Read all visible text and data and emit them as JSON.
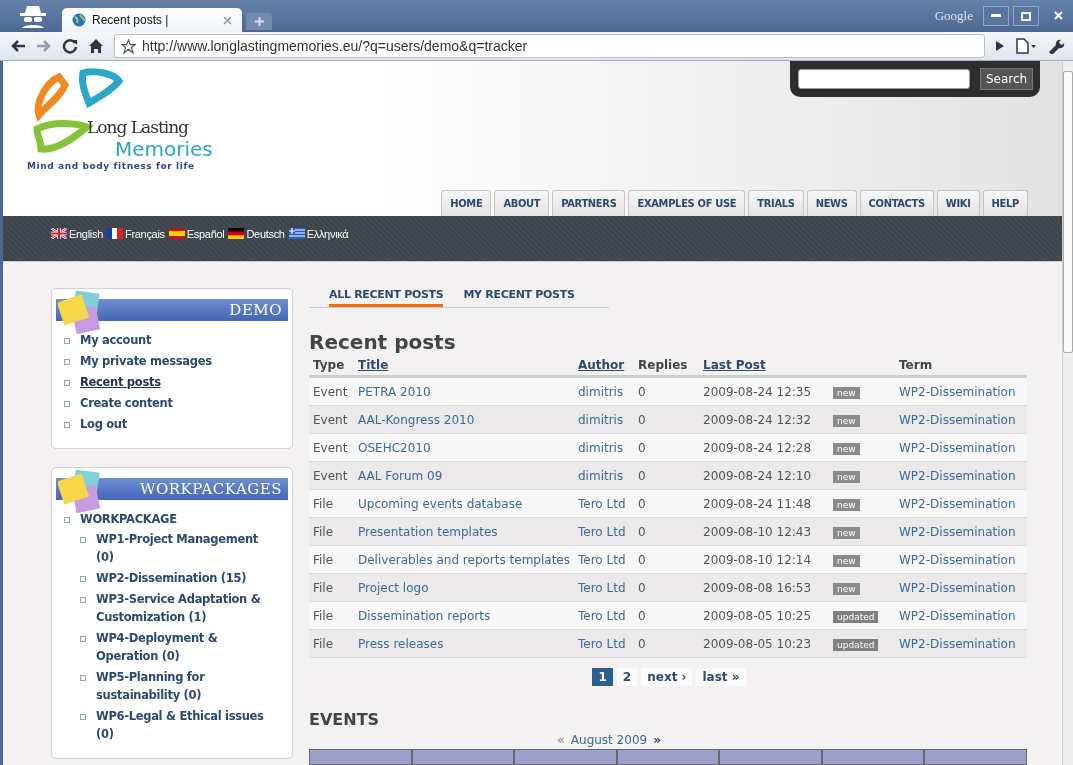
{
  "browser": {
    "tab_title": "Recent posts |",
    "search_engine": "Google",
    "url": "http://www.longlastingmemories.eu/?q=users/demo&q=tracker"
  },
  "site": {
    "logo_line1": "Long Lasting",
    "logo_line2": "Memories",
    "tagline": "Mind and body fitness for life",
    "search_button": "Search",
    "nav": [
      "HOME",
      "ABOUT",
      "PARTNERS",
      "EXAMPLES OF USE",
      "TRIALS",
      "NEWS",
      "CONTACTS",
      "WIKI",
      "HELP"
    ],
    "languages": [
      {
        "label": "English",
        "kind": "uk"
      },
      {
        "label": "Français",
        "kind": "fr"
      },
      {
        "label": "Español",
        "kind": "es"
      },
      {
        "label": "Deutsch",
        "kind": "de"
      },
      {
        "label": "Ελληνικά",
        "kind": "gr"
      }
    ]
  },
  "sidebar": [
    {
      "title": "DEMO",
      "items": [
        {
          "label": "My account",
          "selected": false
        },
        {
          "label": "My private messages",
          "selected": false
        },
        {
          "label": "Recent posts",
          "selected": true
        },
        {
          "label": "Create content",
          "selected": false
        },
        {
          "label": "Log out",
          "selected": false
        }
      ]
    },
    {
      "title": "WORKPACKAGES",
      "items": [
        {
          "label": "WORKPACKAGE",
          "selected": false,
          "children": [
            {
              "label": "WP1-Project Management (0)",
              "selected": false
            },
            {
              "label": "WP2-Dissemination (15)",
              "selected": false
            },
            {
              "label": "WP3-Service Adaptation & Customization (1)",
              "selected": false
            },
            {
              "label": "WP4-Deployment & Operation (0)",
              "selected": false
            },
            {
              "label": "WP5-Planning for sustainability (0)",
              "selected": false
            },
            {
              "label": "WP6-Legal & Ethical issues (0)",
              "selected": false
            }
          ]
        }
      ]
    }
  ],
  "tabs": [
    {
      "label": "ALL RECENT POSTS",
      "selected": true
    },
    {
      "label": "MY RECENT POSTS",
      "selected": false
    }
  ],
  "heading": "Recent posts",
  "table": {
    "columns": [
      {
        "label": "Type",
        "sortable": false
      },
      {
        "label": "Title",
        "sortable": true
      },
      {
        "label": "Author",
        "sortable": true
      },
      {
        "label": "Replies",
        "sortable": false
      },
      {
        "label": "Last Post",
        "sortable": true
      },
      {
        "label": "Term",
        "sortable": false
      }
    ],
    "rows": [
      {
        "type": "Event",
        "title": "PETRA 2010",
        "author": "dimitris",
        "replies": "0",
        "last_post": "2009-08-24 12:35",
        "badge": "new",
        "term": "WP2-Dissemination"
      },
      {
        "type": "Event",
        "title": "AAL-Kongress 2010",
        "author": "dimitris",
        "replies": "0",
        "last_post": "2009-08-24 12:32",
        "badge": "new",
        "term": "WP2-Dissemination"
      },
      {
        "type": "Event",
        "title": "OSEHC2010",
        "author": "dimitris",
        "replies": "0",
        "last_post": "2009-08-24 12:28",
        "badge": "new",
        "term": "WP2-Dissemination"
      },
      {
        "type": "Event",
        "title": "AAL Forum 09",
        "author": "dimitris",
        "replies": "0",
        "last_post": "2009-08-24 12:10",
        "badge": "new",
        "term": "WP2-Dissemination"
      },
      {
        "type": "File",
        "title": "Upcoming events database",
        "author": "Tero Ltd",
        "replies": "0",
        "last_post": "2009-08-24 11:48",
        "badge": "new",
        "term": "WP2-Dissemination"
      },
      {
        "type": "File",
        "title": "Presentation templates",
        "author": "Tero Ltd",
        "replies": "0",
        "last_post": "2009-08-10 12:43",
        "badge": "new",
        "term": "WP2-Dissemination"
      },
      {
        "type": "File",
        "title": "Deliverables and reports templates",
        "author": "Tero Ltd",
        "replies": "0",
        "last_post": "2009-08-10 12:14",
        "badge": "new",
        "term": "WP2-Dissemination"
      },
      {
        "type": "File",
        "title": "Project logo",
        "author": "Tero Ltd",
        "replies": "0",
        "last_post": "2009-08-08 16:53",
        "badge": "new",
        "term": "WP2-Dissemination"
      },
      {
        "type": "File",
        "title": "Dissemination reports",
        "author": "Tero Ltd",
        "replies": "0",
        "last_post": "2009-08-05 10:25",
        "badge": "updated",
        "term": "WP2-Dissemination"
      },
      {
        "type": "File",
        "title": "Press releases",
        "author": "Tero Ltd",
        "replies": "0",
        "last_post": "2009-08-05 10:23",
        "badge": "updated",
        "term": "WP2-Dissemination"
      }
    ]
  },
  "pager": [
    {
      "label": "1",
      "selected": true
    },
    {
      "label": "2",
      "selected": false
    },
    {
      "label": "next ›",
      "selected": false
    },
    {
      "label": "last »",
      "selected": false
    }
  ],
  "events": {
    "heading": "EVENTS",
    "prev": {
      "label": "«",
      "disabled": true
    },
    "month": "August 2009",
    "next": {
      "label": "»",
      "disabled": false
    }
  }
}
